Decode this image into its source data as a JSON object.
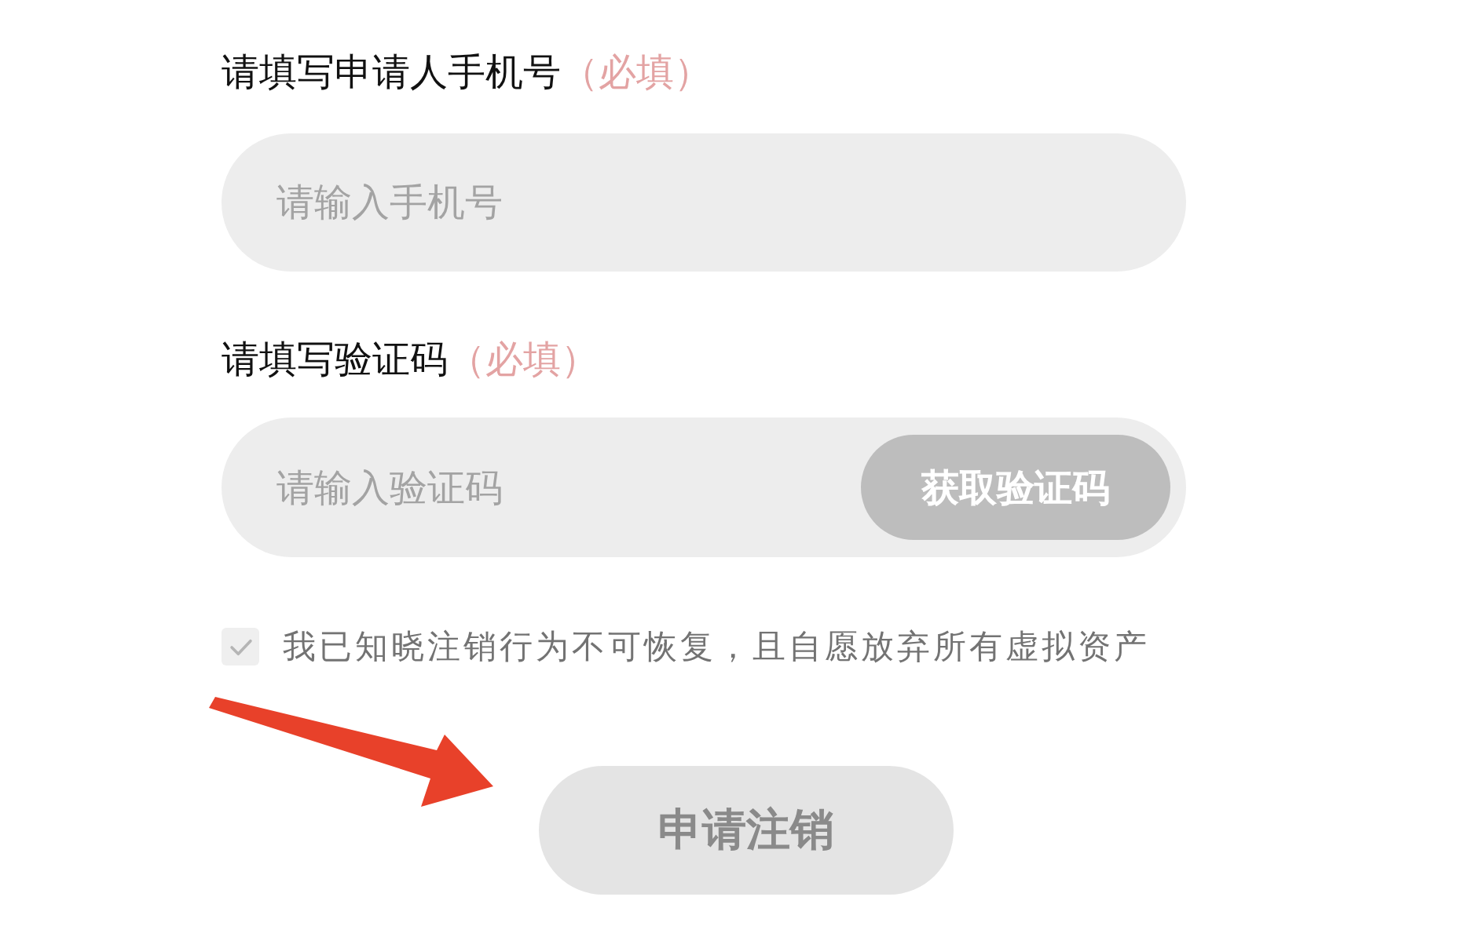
{
  "phone_field": {
    "label": "请填写申请人手机号",
    "required_note": "（必填）",
    "placeholder": "请输入手机号"
  },
  "code_field": {
    "label": "请填写验证码",
    "required_note": "（必填）",
    "placeholder": "请输入验证码",
    "get_code_button": "获取验证码"
  },
  "agreement": {
    "checked": true,
    "text": "我已知晓注销行为不可恢复，且自愿放弃所有虚拟资产"
  },
  "submit_button": "申请注销"
}
